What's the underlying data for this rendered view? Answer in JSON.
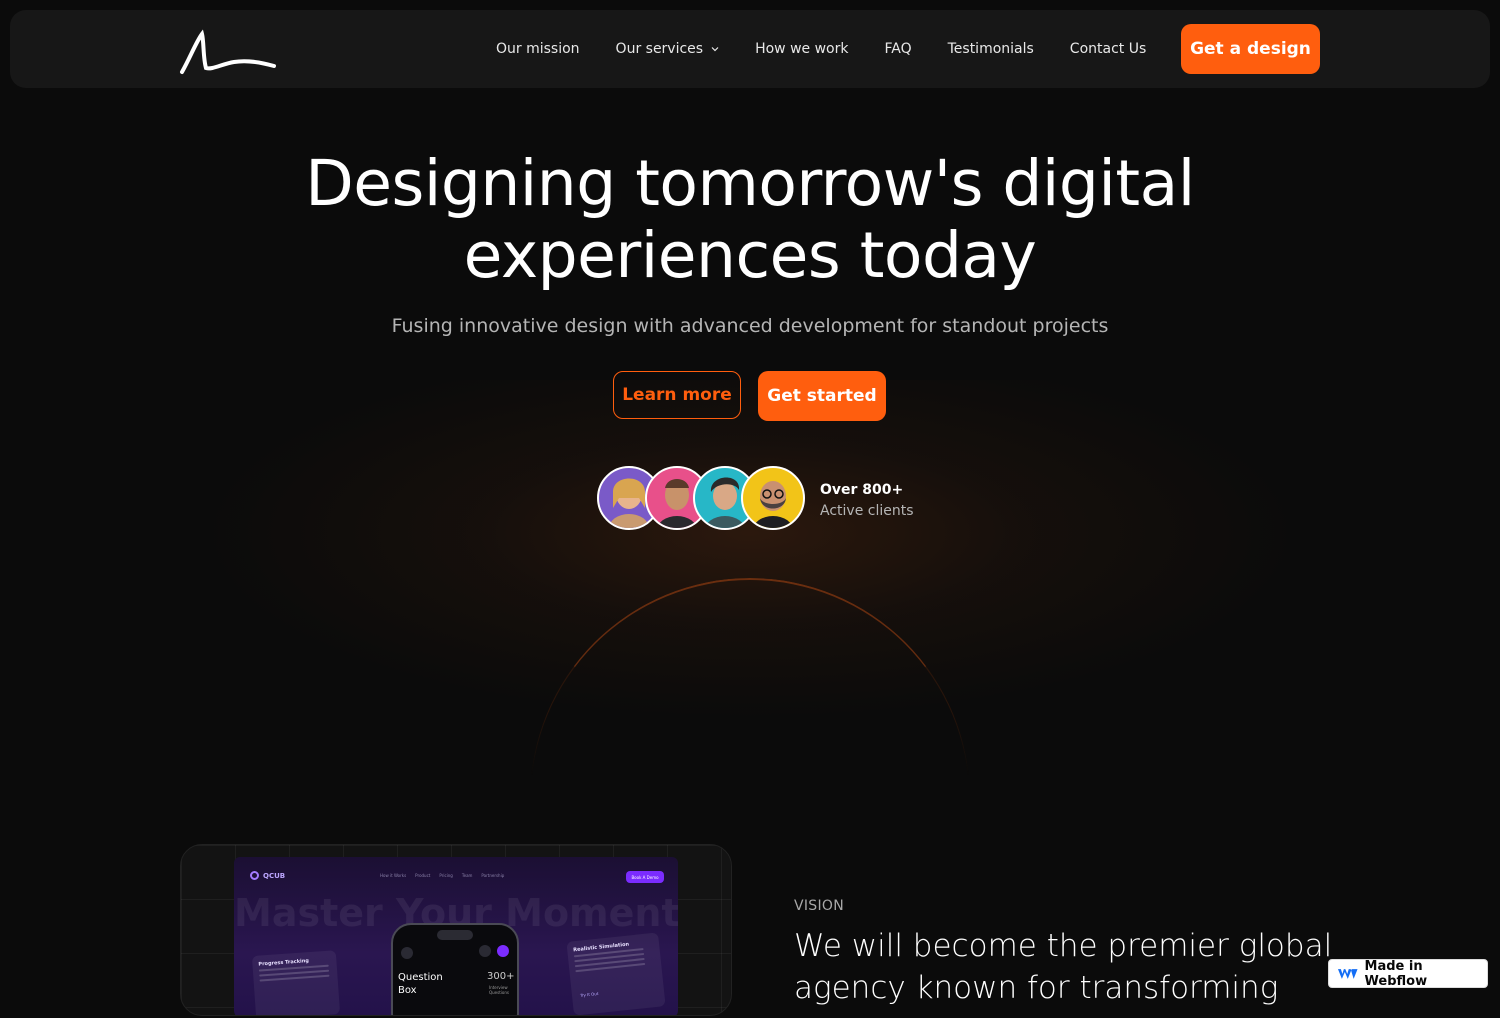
{
  "nav": {
    "links": [
      {
        "label": "Our mission"
      },
      {
        "label": "Our services"
      },
      {
        "label": "How we work"
      },
      {
        "label": "FAQ"
      },
      {
        "label": "Testimonials"
      },
      {
        "label": "Contact Us"
      }
    ],
    "cta_label": "Get a design"
  },
  "hero": {
    "title_line1": "Designing tomorrow's digital",
    "title_line2": "experiences today",
    "subtitle": "Fusing innovative design with advanced development for standout projects",
    "learn_more_label": "Learn more",
    "get_started_label": "Get started",
    "clients_count": "Over 800+",
    "clients_label": "Active clients"
  },
  "showcase": {
    "brand": "QCUB",
    "nav_items": [
      "How it Works",
      "Product",
      "Pricing",
      "Team",
      "Partnership"
    ],
    "cta": "Book A Demo",
    "big_text": "Master Your Moment",
    "left_card_title": "Progress Tracking",
    "right_card_title": "Realistic Simulation",
    "right_card_link": "Try It Out",
    "phone_title": "Question Box",
    "phone_count": "300+",
    "phone_count_label": "Interview Questions"
  },
  "vision": {
    "label": "VISION",
    "text": "We will become the premier global agency known for transforming"
  },
  "badge": {
    "label": "Made in Webflow"
  },
  "colors": {
    "accent": "#ff5e0e",
    "background": "#0b0b0b",
    "navbar": "#171717"
  }
}
